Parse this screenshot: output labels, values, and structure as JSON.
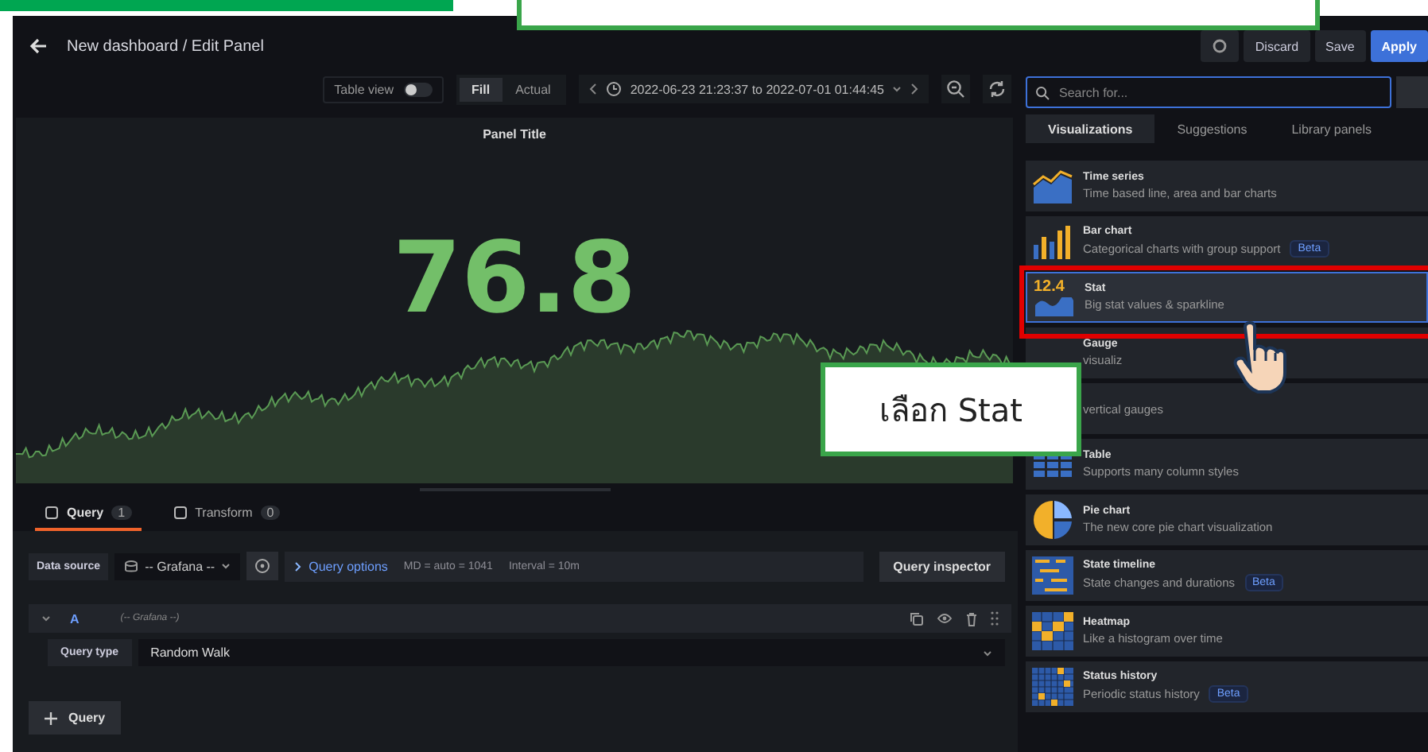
{
  "header": {
    "breadcrumb": "New dashboard / Edit Panel",
    "buttons": [
      {
        "label": "Discard",
        "kind": "secondary"
      },
      {
        "label": "Save",
        "kind": "secondary"
      },
      {
        "label": "Apply",
        "kind": "primary"
      }
    ]
  },
  "toolbar": {
    "table_view": {
      "label": "Table view",
      "on": false
    },
    "modes": [
      {
        "label": "Fill",
        "selected": true
      },
      {
        "label": "Actual",
        "selected": false
      }
    ],
    "time_range": "2022-06-23 21:23:37 to 2022-07-01 01:44:45"
  },
  "panel": {
    "title": "Panel Title",
    "value": "76.8"
  },
  "query_tabs": [
    {
      "label": "Query",
      "count": "1",
      "selected": true
    },
    {
      "label": "Transform",
      "count": "0",
      "selected": false
    }
  ],
  "query_bar": {
    "data_source_label": "Data source",
    "data_source": "-- Grafana --",
    "options_link": "Query options",
    "max_data_points": "MD = auto = 1041",
    "interval": "Interval = 10m",
    "inspector_button": "Query inspector"
  },
  "query": {
    "ref": "A",
    "source": "(-- Grafana --)",
    "fields": [
      {
        "label": "Query type",
        "value": "Random Walk"
      }
    ],
    "add_button": "Query"
  },
  "sidebar": {
    "search": {
      "placeholder": "Search for..."
    },
    "tabs": [
      {
        "label": "Visualizations",
        "selected": true
      },
      {
        "label": "Suggestions",
        "selected": false
      },
      {
        "label": "Library panels",
        "selected": false
      }
    ],
    "items": [
      {
        "kind": "timeseries",
        "title": "Time series",
        "description": "Time based line, area and bar charts",
        "selected": false
      },
      {
        "kind": "bar",
        "title": "Bar chart",
        "description": "Categorical charts with group support",
        "badge": "Beta",
        "selected": false
      },
      {
        "kind": "stat",
        "icon_text": "12.4",
        "title": "Stat",
        "description": "Big stat values & sparkline",
        "selected": true
      },
      {
        "kind": "gauge",
        "title": "Gauge",
        "description": "visualiz",
        "selected": false
      },
      {
        "kind": "bargauge",
        "description": "vertical gauges",
        "selected": false
      },
      {
        "kind": "table",
        "title": "Table",
        "description": "Supports many column styles",
        "selected": false
      },
      {
        "kind": "pie",
        "title": "Pie chart",
        "description": "The new core pie chart visualization",
        "selected": false
      },
      {
        "kind": "timeline",
        "title": "State timeline",
        "description": "State changes and durations",
        "badge": "Beta",
        "selected": false
      },
      {
        "kind": "heatmap",
        "title": "Heatmap",
        "description": "Like a histogram over time",
        "selected": false
      },
      {
        "kind": "status",
        "title": "Status history",
        "description": "Periodic status history",
        "badge": "Beta",
        "selected": false
      }
    ]
  },
  "callout": {
    "text": "เลือก Stat"
  }
}
